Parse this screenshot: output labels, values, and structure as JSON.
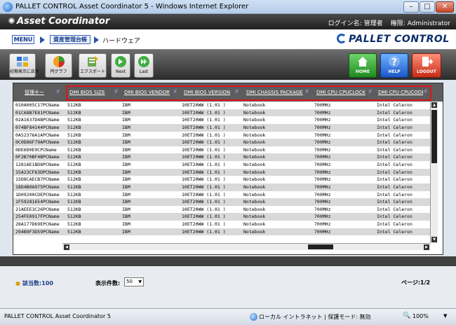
{
  "browser": {
    "window_title": "PALLET CONTROL Asset Coordinator 5 - Windows Internet Explorer",
    "status_text": "PALLET CONTROL Asset Coordinator 5",
    "zone_text": "ローカル イントラネット | 保護モード: 無効",
    "zoom": "100%"
  },
  "header": {
    "app_name": "Asset Coordinator",
    "login_label": "ログイン名:",
    "login_value": "管理者",
    "role_label": "権限:",
    "role_value": "Administrator"
  },
  "breadcrumb": {
    "menu": "MENU",
    "ledger": "資産管理台帳",
    "current": "ハードウェア"
  },
  "brand": "PALLET CONTROL",
  "toolbar": {
    "reset": "初期表示に戻す",
    "pie": "円グラフ",
    "export": "エクスポート",
    "next": "Next",
    "last": "Last",
    "home": "HOME",
    "help": "HELP",
    "logout": "LOGOUT"
  },
  "grid": {
    "columns": [
      "管理キー",
      "DMI BIOS SIZE",
      "DMI BIOS VENDOR",
      "DMI BIOS VERSION",
      "DMI CHASSIS PACKAGE",
      "DMI CPU CPUCLOCK",
      "DMI CPU CPUCODE"
    ],
    "rows": [
      [
        "010A005C17PCName",
        "512KB",
        "IBM",
        "10ET20WW (1.01 )",
        "Notebook",
        "700MHz",
        "Intel Celeron"
      ],
      [
        "01C68B7E81PCName",
        "512KB",
        "IBM",
        "10ET20WW (1.01 )",
        "Notebook",
        "700MHz",
        "Intel Celeron"
      ],
      [
        "02A1637D4BPCName",
        "512KB",
        "IBM",
        "10ET20WW (1.01 )",
        "Notebook",
        "700MHz",
        "Intel Celeron"
      ],
      [
        "074BF84144PCName",
        "512KB",
        "IBM",
        "10ET20WW (1.01 )",
        "Notebook",
        "700MHz",
        "Intel Celeron"
      ],
      [
        "0A52376A1APCName",
        "512KB",
        "IBM",
        "10ET20WW (1.01 )",
        "Notebook",
        "700MHz",
        "Intel Celeron"
      ],
      [
        "0C0D86F79APCName",
        "512KB",
        "IBM",
        "10ET20WW (1.01 )",
        "Notebook",
        "700MHz",
        "Intel Celeron"
      ],
      [
        "0DE6D0E9CPCName",
        "512KB",
        "IBM",
        "10ET20WW (1.01 )",
        "Notebook",
        "700MHz",
        "Intel Celeron"
      ],
      [
        "0F2B70BF4BPCName",
        "512KB",
        "IBM",
        "10ET20WW (1.01 )",
        "Notebook",
        "700MHz",
        "Intel Celeron"
      ],
      [
        "1281AE1BD8PCName",
        "512KB",
        "IBM",
        "10ET20WW (1.01 )",
        "Notebook",
        "700MHz",
        "Intel Celeron"
      ],
      [
        "15A23CF63DPCName",
        "512KB",
        "IBM",
        "10ET20WW (1.01 )",
        "Notebook",
        "700MHz",
        "Intel Celeron"
      ],
      [
        "15D8CAECB7PCName",
        "512KB",
        "IBM",
        "10ET20WW (1.01 )",
        "Notebook",
        "700MHz",
        "Intel Celeron"
      ],
      [
        "18D4B0A975PCName",
        "512KB",
        "IBM",
        "10ET20WW (1.01 )",
        "Notebook",
        "700MHz",
        "Intel Celeron"
      ],
      [
        "1D09200CDEPCName",
        "512KB",
        "IBM",
        "10ET20WW (1.01 )",
        "Notebook",
        "700MHz",
        "Intel Celeron"
      ],
      [
        "1F59281654PCName",
        "512KB",
        "IBM",
        "10ET20WW (1.01 )",
        "Notebook",
        "700MHz",
        "Intel Celeron"
      ],
      [
        "21AEEE3C26PCName",
        "512KB",
        "IBM",
        "10ET20WW (1.01 )",
        "Notebook",
        "700MHz",
        "Intel Celeron"
      ],
      [
        "254FE0917FPCName",
        "512KB",
        "IBM",
        "10ET20WW (1.01 )",
        "Notebook",
        "700MHz",
        "Intel Celeron"
      ],
      [
        "28A177D69EPCName",
        "512KB",
        "IBM",
        "10ET20WW (1.01 )",
        "Notebook",
        "700MHz",
        "Intel Celeron"
      ],
      [
        "294B9F3D59PCName",
        "512KB",
        "IBM",
        "10ET20WW (1.01 )",
        "Notebook",
        "700MHz",
        "Intel Celeron"
      ]
    ]
  },
  "footer": {
    "count": "該当数:100",
    "perpage_label": "表示件数:",
    "perpage_value": "50",
    "page": "ページ:1/2"
  },
  "colors": {
    "highlight": "#e0121b",
    "header_bg": "#5d5d5d",
    "link_blue": "#1d3f8c"
  }
}
